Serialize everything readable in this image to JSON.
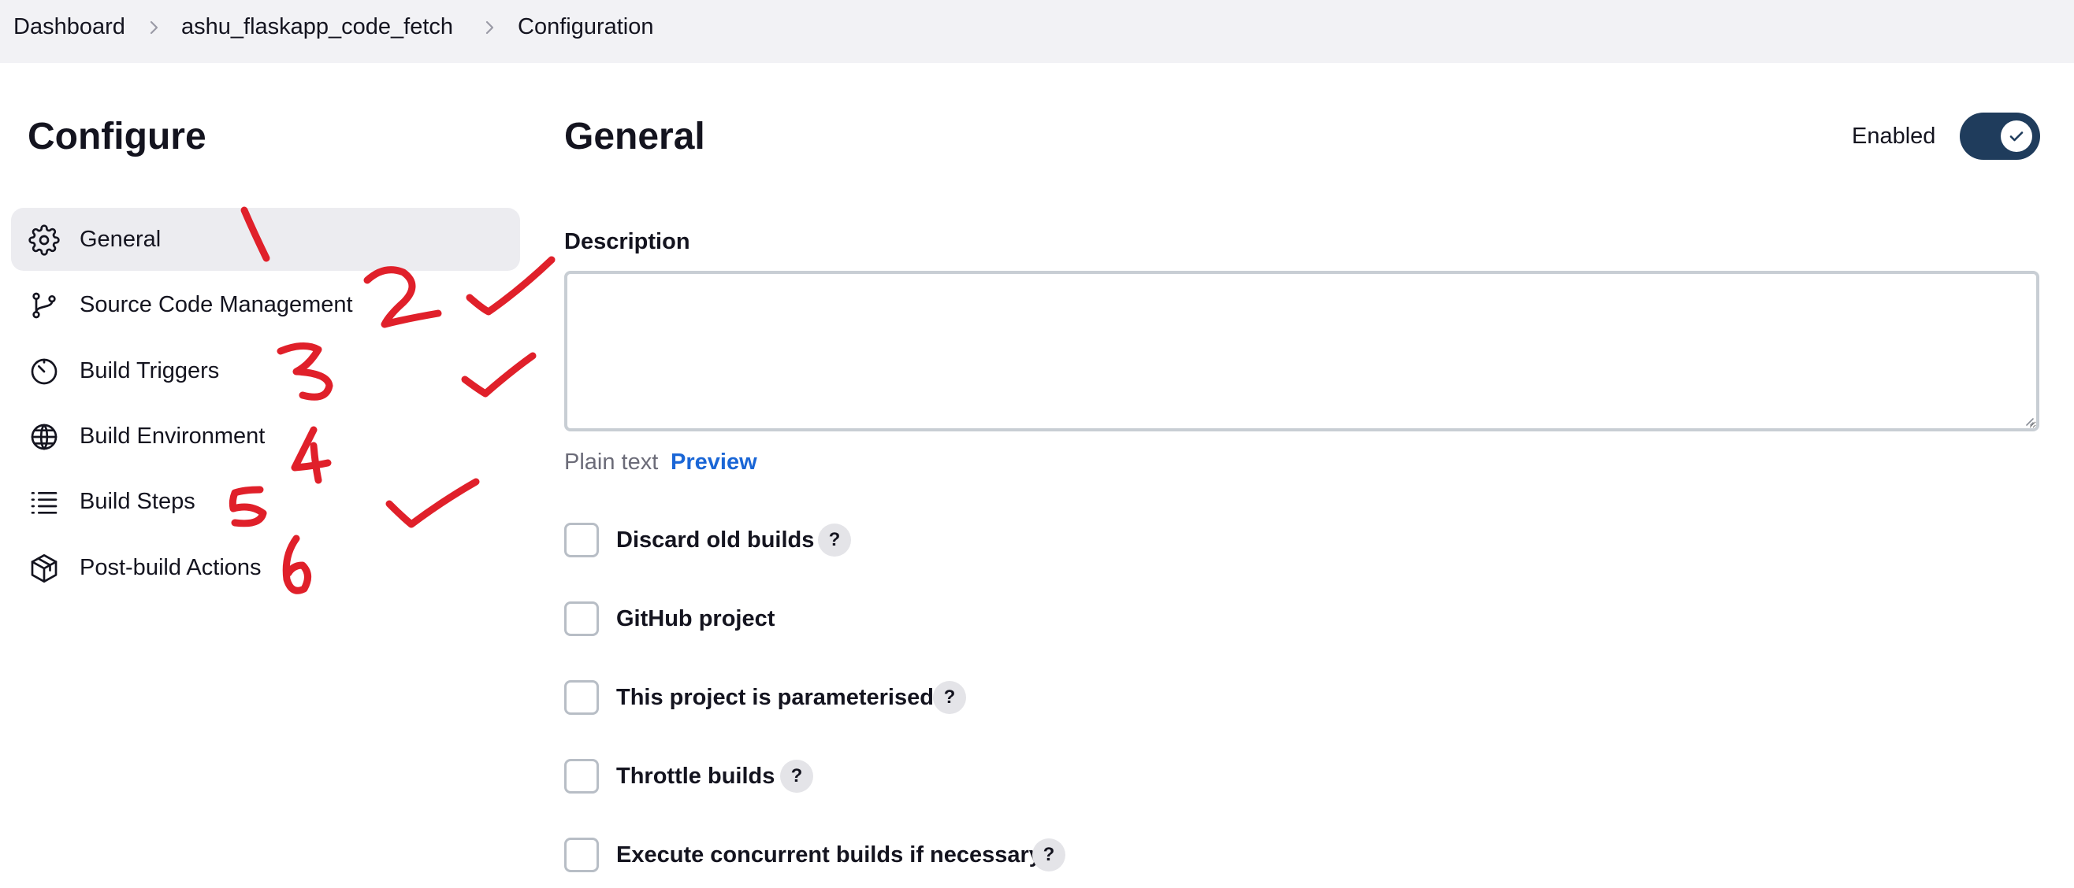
{
  "breadcrumb": {
    "items": [
      "Dashboard",
      "ashu_flaskapp_code_fetch",
      "Configuration"
    ]
  },
  "sidebar": {
    "title": "Configure",
    "items": [
      {
        "label": "General",
        "icon": "gear-icon",
        "active": true
      },
      {
        "label": "Source Code Management",
        "icon": "git-branch-icon"
      },
      {
        "label": "Build Triggers",
        "icon": "timer-icon"
      },
      {
        "label": "Build Environment",
        "icon": "globe-icon"
      },
      {
        "label": "Build Steps",
        "icon": "list-icon"
      },
      {
        "label": "Post-build Actions",
        "icon": "package-icon"
      }
    ]
  },
  "main": {
    "title": "General",
    "enabled_label": "Enabled",
    "enabled": true,
    "description_label": "Description",
    "description_value": "",
    "format_text": "Plain text",
    "preview_label": "Preview",
    "options": [
      {
        "label": "Discard old builds",
        "checked": false,
        "help": "?"
      },
      {
        "label": "GitHub project",
        "checked": false
      },
      {
        "label": "This project is parameterised",
        "checked": false,
        "help": "?"
      },
      {
        "label": "Throttle builds",
        "checked": false,
        "help": "?"
      },
      {
        "label": "Execute concurrent builds if necessary",
        "checked": false,
        "help": "?"
      }
    ]
  },
  "annotations": {
    "numbers": [
      "1",
      "2",
      "3",
      "4",
      "5",
      "6"
    ],
    "checkmark_count": 3,
    "color": "#e0202a"
  },
  "colors": {
    "accent_toggle": "#1f3c5c",
    "link": "#1a66d6",
    "active_item_bg": "#ececf0",
    "breadcrumb_bg": "#f2f2f5"
  }
}
